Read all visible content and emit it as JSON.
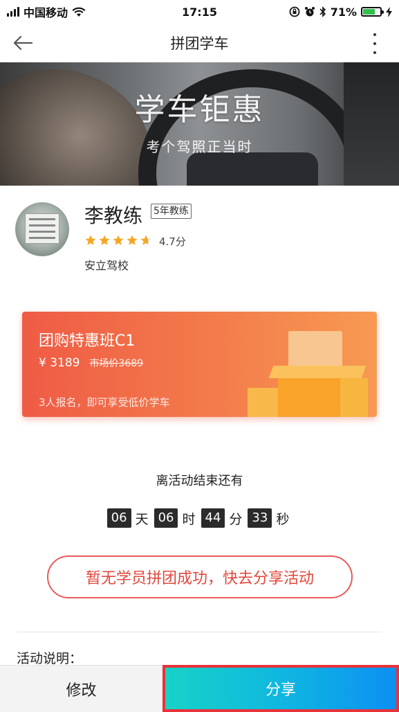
{
  "status_bar": {
    "carrier": "中国移动",
    "time": "17:15",
    "battery": "71%",
    "battery_level": 0.71,
    "icons": [
      "signal-icon",
      "wifi-icon",
      "lock-rotation-icon",
      "alarm-icon",
      "bluetooth-icon",
      "battery-icon",
      "charging-icon"
    ]
  },
  "nav": {
    "title": "拼团学车",
    "back_icon": "arrow-left-icon",
    "more_icon": "more-vertical-icon"
  },
  "banner": {
    "title": "学车钜惠",
    "subtitle": "考个驾照正当时"
  },
  "coach": {
    "name": "李教练",
    "badge": "5年教练",
    "rating": "4.7分",
    "stars": 4.7,
    "school": "安立驾校"
  },
  "promo": {
    "title": "团购特惠班C1",
    "price": "¥ 3189",
    "old_price": "市场价3689",
    "note": "3人报名，即可享受低价学车"
  },
  "countdown": {
    "label": "离活动结束还有",
    "days": "06",
    "days_unit": "天",
    "hours": "06",
    "hours_unit": "时",
    "minutes": "44",
    "minutes_unit": "分",
    "seconds": "33",
    "seconds_unit": "秒"
  },
  "cta": {
    "label": "暂无学员拼团成功，快去分享活动"
  },
  "rules": {
    "title": "活动说明："
  },
  "bottom_bar": {
    "edit_label": "修改",
    "share_label": "分享"
  },
  "colors": {
    "accent_red": "#e0473c",
    "star": "#f6a623",
    "share_start": "#17d3c6",
    "share_end": "#0c8ff3",
    "promo_start": "#ef5b45",
    "promo_end": "#f79a52"
  }
}
